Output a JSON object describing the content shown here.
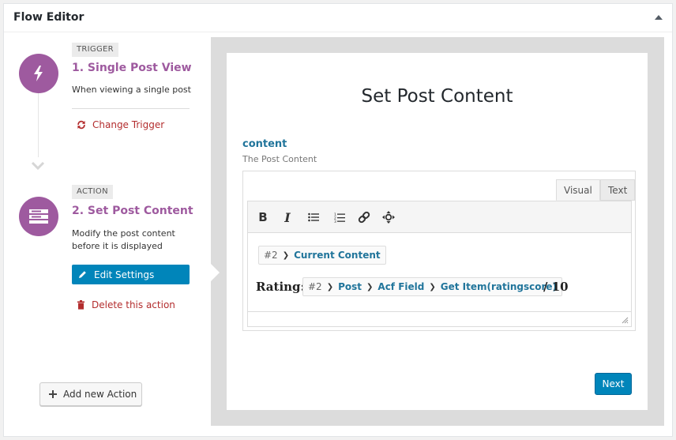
{
  "panel": {
    "title": "Flow Editor"
  },
  "trigger": {
    "badge": "TRIGGER",
    "title": "1. Single Post View",
    "description": "When viewing a single post",
    "change_label": "Change Trigger"
  },
  "action": {
    "badge": "ACTION",
    "title": "2. Set Post Content",
    "description_line1": "Modify the post content",
    "description_line2": "before it is displayed",
    "edit_label": "Edit Settings",
    "delete_label": "Delete this action"
  },
  "add_action_label": "Add new Action",
  "card": {
    "title": "Set Post Content",
    "field_label": "content",
    "field_description": "The Post Content",
    "tabs": {
      "visual": "Visual",
      "text": "Text"
    },
    "toolbar": [
      "bold-icon",
      "italic-icon",
      "bulleted-list-icon",
      "numbered-list-icon",
      "link-icon",
      "move-icon"
    ],
    "token1": {
      "num": "#2",
      "parts": [
        "Current Content"
      ]
    },
    "rating_label": "Rating:",
    "token2": {
      "num": "#2",
      "parts": [
        "Post",
        "Acf Field",
        "Get Item(ratingscore)"
      ]
    },
    "rating_suffix": "/ 10",
    "next_label": "Next"
  },
  "colors": {
    "accent_purple": "#9e5a9f",
    "primary_blue": "#0085ba",
    "danger_red": "#b32d2e",
    "link_blue": "#21759b"
  }
}
